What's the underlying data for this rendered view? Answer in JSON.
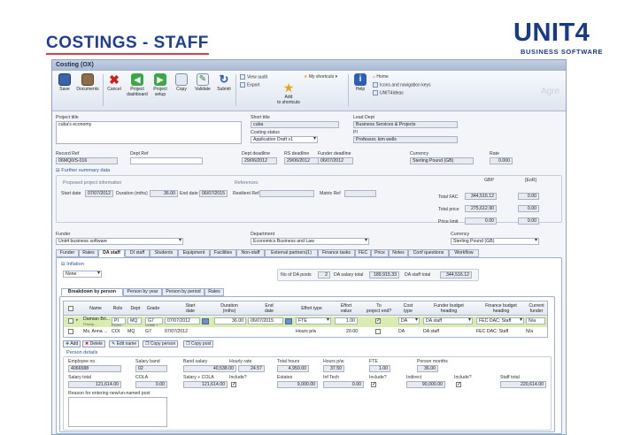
{
  "slide": {
    "title": "COSTINGS - STAFF",
    "logo": "UNIT4",
    "logo_sub": "BUSINESS SOFTWARE"
  },
  "window": {
    "title": "Costing (OX)",
    "watermark": "Agre"
  },
  "toolbar": {
    "buttons": [
      "Save",
      "Documents",
      "Cancel",
      "Project\ndashboard",
      "Project\nsetup",
      "Copy",
      "Validate",
      "Submit"
    ],
    "view_audit": "View audit",
    "export": "Export",
    "my_shortcuts": "My shortcuts",
    "add_to_shortcuts": "Add\nto shortcuts",
    "help": "Help",
    "home": "Home",
    "icons_nav": "Icons and navigation keys",
    "unit4ideas": "UNIT4Ideas"
  },
  "header": {
    "project_title_label": "Project title",
    "project_title": "cuba's economy",
    "short_title_label": "Short title",
    "short_title": "cuba",
    "lead_dept_label": "Lead Dept",
    "lead_dept": "Business Services & Projects",
    "costing_status_label": "Costing status",
    "costing_status": "Application Draft v1",
    "pi_label": "PI",
    "pi": "Professor, kim wells",
    "record_ref_label": "Record Ref",
    "record_ref": "06MQ0/S-016",
    "dept_ref_label": "Dept Ref",
    "dept_ref": "",
    "dept_deadline_label": "Dept deadline",
    "dept_deadline": "29/06/2012",
    "rs_deadline_label": "RS deadline",
    "rs_deadline": "29/06/2012",
    "funder_deadline_label": "Funder deadline",
    "funder_deadline": "06/07/2012",
    "currency_label": "Currency",
    "currency": "Sterling Pound (GB)",
    "rate_label": "Rate",
    "rate": "0.000"
  },
  "summary": {
    "title": "Further summary data",
    "proposed_title": "Proposed project information",
    "references_title": "References",
    "start_date_label": "Start date",
    "start_date": "07/07/2012",
    "duration_label": "Duration (mths)",
    "duration": "36.00",
    "end_date_label": "End date",
    "end_date": "06/07/2015",
    "resilient_ref_label": "Resilient Ref",
    "matrix_ref_label": "Matrix Ref",
    "gbp_label": "GBP",
    "eur_label": "[EoR]",
    "total_fac_label": "Total FAC",
    "total_fac": "344,516.12",
    "total_fac_eur": "0.00",
    "total_price_label": "Total price",
    "total_price": "275,612.90",
    "total_price_eur": "0.00",
    "price_limit_label": "Price limit",
    "price_limit": "0.00",
    "price_limit_eur": "0.00"
  },
  "funder_row": {
    "funder_label": "Funder",
    "funder": "Unit4 business software",
    "department_label": "Department",
    "department": "Economics Business and Law",
    "currency_label": "Currency",
    "currency": "Sterling Pound (GB)"
  },
  "tabs": [
    "Funder",
    "Rates",
    "DA staff",
    "DI staff",
    "Students",
    "Equipment",
    "Facilities",
    "Non-staff",
    "External partners(1)",
    "Finance tasks",
    "FEC",
    "Price",
    "Notes",
    "Conf questions",
    "Workflow"
  ],
  "inflation": {
    "label": "Inflation",
    "value": "None"
  },
  "da_totals": {
    "posts_label": "No of DA posts",
    "posts": "2",
    "salary_label": "DA salary total",
    "salary": "189,915.33",
    "staff_label": "DA staff total",
    "staff": "344,516.12"
  },
  "subtabs": [
    "Breakdown by person",
    "Person by year",
    "Person by period",
    "Rates"
  ],
  "grid": {
    "headers": [
      "Name",
      "Role",
      "Dept",
      "Grade",
      "Start\ndate",
      "Duration\n(mths)",
      "End\ndate",
      "Effort type",
      "Effort\nvalue",
      "To\nproject end?",
      "Cost\ntype",
      "Funder budget\nheading",
      "Finance budget\nheading",
      "Current\nfunder"
    ],
    "rows": [
      {
        "name": "Damian Bri...",
        "name_sub": "Princip...",
        "role": "PI",
        "role_sub": "Econo...",
        "dept": "MQ",
        "dept_sub": "Grade 7",
        "grade": "G7",
        "start": "07/07/2012",
        "duration": "36.00",
        "end": "06/07/2015",
        "effort_type": "FTE",
        "effort_value": "1.00",
        "cost_type": "DA",
        "funder_budget": "DA staff",
        "finance_budget": "FEC DAC: Staff",
        "current_funder": "N/a"
      },
      {
        "name": "Ms, Anna ...",
        "role": "COI",
        "dept": "MQ",
        "grade": "G7",
        "start": "07/07/2012",
        "duration": "",
        "end": "",
        "effort_type": "Hours p/w",
        "effort_value": "20.00",
        "cost_type": "DA",
        "funder_budget": "DA staff",
        "finance_budget": "FEC DAC: Staff",
        "current_funder": "N/a"
      }
    ],
    "buttons": [
      "Add",
      "Delete",
      "Edit name",
      "Copy person",
      "Copy post"
    ]
  },
  "person": {
    "title": "Person details",
    "employee_no_label": "Employee no.",
    "employee_no": "4066588",
    "salary_band_label": "Salary band",
    "salary_band": "02",
    "band_salary_label": "Band salary",
    "band_salary": "40,538.00",
    "hourly_rate_label": "Hourly rate",
    "hourly_rate": "24.57",
    "total_hours_label": "Total hours",
    "total_hours": "4,950.00",
    "hours_pw_label": "Hours p/w",
    "hours_pw": "37.50",
    "fte_label": "FTE",
    "fte": "1.00",
    "person_months_label": "Person months",
    "person_months": "36.00",
    "salary_total_label": "Salary total",
    "salary_total": "121,614.00",
    "cola_label": "COLA",
    "cola": "0.00",
    "salary_cola_label": "Salary + COLA",
    "salary_cola": "121,614.00",
    "include1_label": "Include?",
    "estates_label": "Estates",
    "estates": "9,000.00",
    "inf_tech_label": "Inf Tech",
    "inf_tech": "0.00",
    "include2_label": "Include?",
    "indirect_label": "Indirect",
    "indirect": "90,000.00",
    "include3_label": "Include?",
    "staff_total_label": "Staff total",
    "staff_total": "220,614.00",
    "reason_label": "Reason for entering new/un-named post"
  }
}
